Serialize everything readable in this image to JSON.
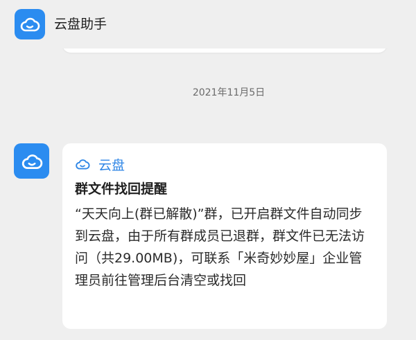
{
  "header": {
    "title": "云盘助手",
    "avatar_icon": "cloud-icon"
  },
  "timestamp": "2021年11月5日",
  "message": {
    "avatar_icon": "cloud-icon",
    "source_icon": "cloud-icon",
    "source_label": "云盘",
    "title": "群文件找回提醒",
    "body": "“天天向上(群已解散)”群，已开启群文件自动同步到云盘，由于所有群成员已退群，群文件已无法访问（共29.00MB)，可联系「米奇妙妙屋」企业管理员前往管理后台清空或找回"
  },
  "colors": {
    "background": "#efefef",
    "accent": "#2b8cf0",
    "link": "#2f86e6",
    "card": "#ffffff"
  }
}
